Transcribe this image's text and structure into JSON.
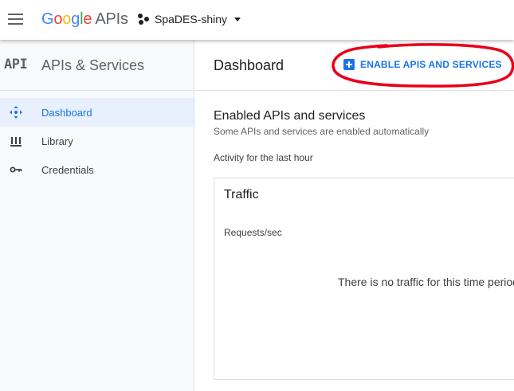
{
  "topbar": {
    "logo_google_letters": [
      "G",
      "o",
      "o",
      "g",
      "l",
      "e"
    ],
    "logo_suffix": "APIs",
    "project_name": "SpaDES-shiny",
    "menu_icon": "hamburger-menu-icon",
    "project_icon": "project-dots-icon",
    "dropdown_icon": "caret-down-icon"
  },
  "sidebar": {
    "badge": "API",
    "title": "APIs & Services",
    "items": [
      {
        "label": "Dashboard",
        "icon": "dashboard-icon",
        "active": true
      },
      {
        "label": "Library",
        "icon": "library-icon",
        "active": false
      },
      {
        "label": "Credentials",
        "icon": "key-icon",
        "active": false
      }
    ]
  },
  "main": {
    "page_title": "Dashboard",
    "enable_button": "ENABLE APIS AND SERVICES",
    "enabled_title": "Enabled APIs and services",
    "enabled_subtitle": "Some APIs and services are enabled automatically",
    "activity_label": "Activity for the last hour",
    "traffic_card": {
      "title": "Traffic",
      "ylabel": "Requests/sec",
      "empty_message": "There is no traffic for this time period"
    }
  },
  "colors": {
    "accent": "#1a73e8",
    "active_bg": "#e8f0fe",
    "annotation": "#e8001c"
  }
}
